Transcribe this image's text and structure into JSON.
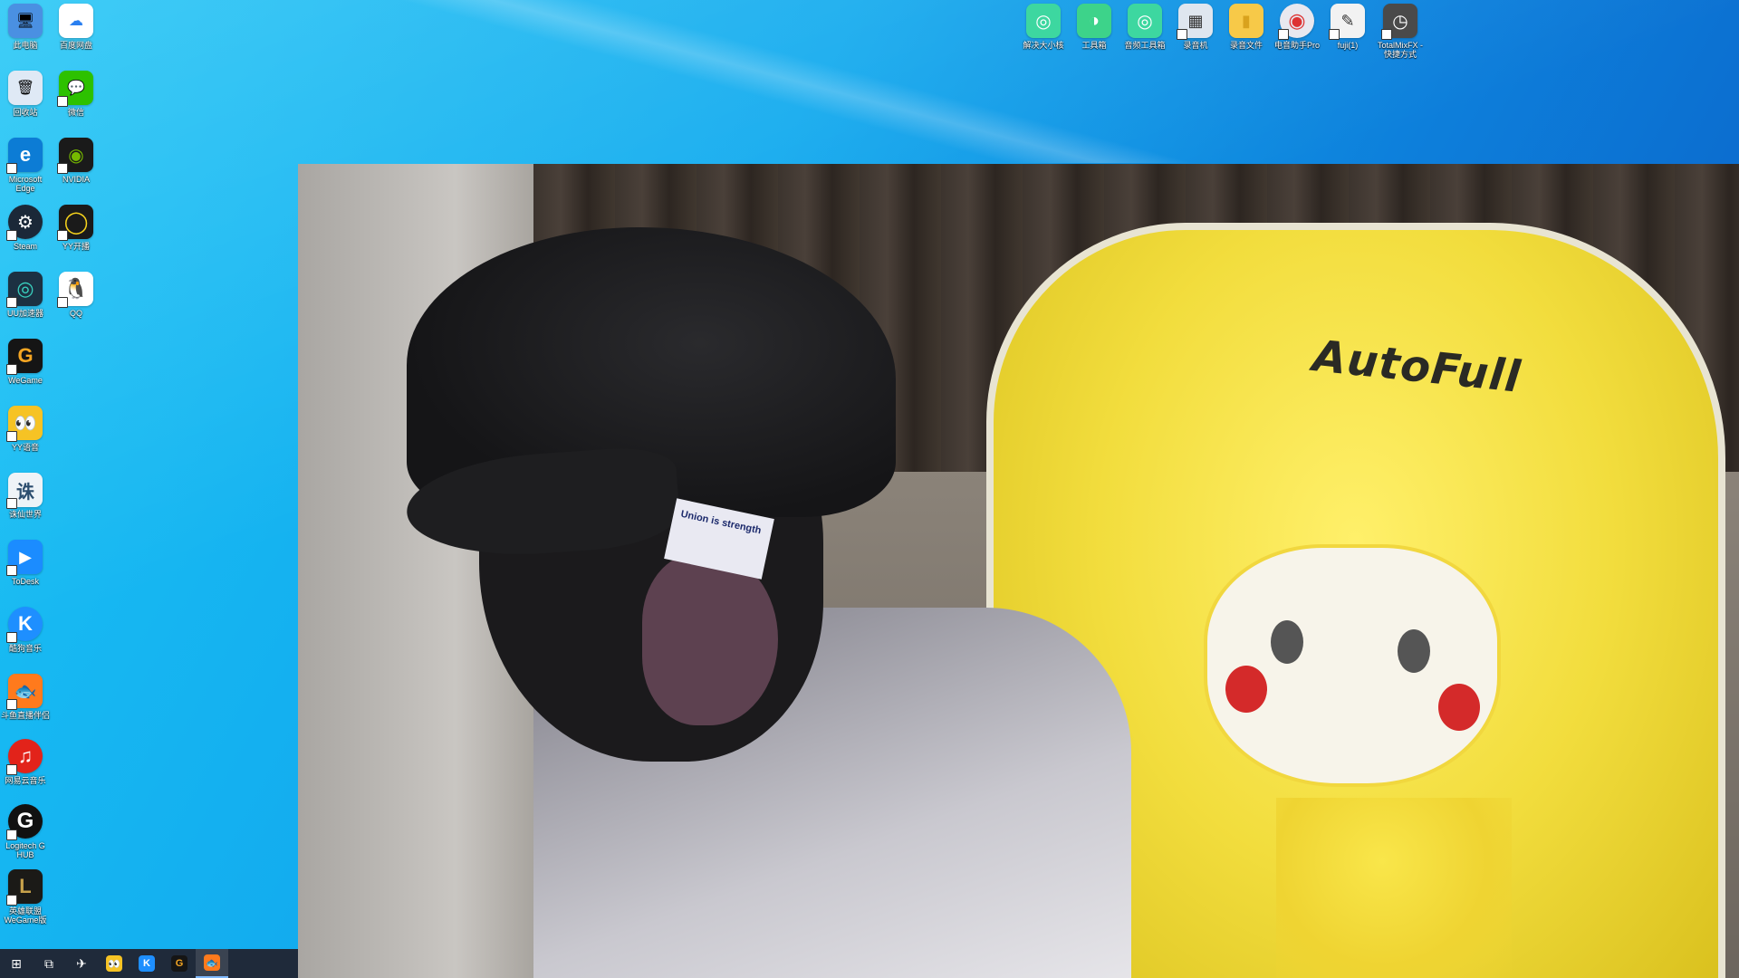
{
  "desktop_icons_left": [
    {
      "label": "此电脑",
      "icon": "computer-icon",
      "color": "#4a90e2",
      "glyph": "🖥"
    },
    {
      "label": "百度网盘",
      "icon": "baidu-netdisk-icon",
      "color": "#ffffff",
      "glyph": "☁"
    },
    {
      "label": "回收站",
      "icon": "recycle-bin-icon",
      "color": "#dfe9f5",
      "glyph": "🗑"
    },
    {
      "label": "微信",
      "icon": "wechat-icon",
      "color": "#2dc100",
      "glyph": "💬"
    },
    {
      "label": "Microsoft Edge",
      "icon": "edge-icon",
      "color": "#0c7cd5",
      "glyph": "e"
    },
    {
      "label": "NVIDIA",
      "icon": "nvidia-icon",
      "color": "#1a1a1a",
      "glyph": "◉"
    },
    {
      "label": "Steam",
      "icon": "steam-icon",
      "color": "#1b2838",
      "glyph": "⚙"
    },
    {
      "label": "YY开播",
      "icon": "yy-live-icon",
      "color": "#1a1a1a",
      "glyph": "◯"
    },
    {
      "label": "UU加速器",
      "icon": "uu-accelerator-icon",
      "color": "#1c3142",
      "glyph": "◎"
    },
    {
      "label": "QQ",
      "icon": "qq-icon",
      "color": "#ffffff",
      "glyph": "🐧"
    },
    {
      "label": "WeGame",
      "icon": "wegame-icon",
      "color": "#151515",
      "glyph": "G"
    },
    {
      "label": "YY语音",
      "icon": "yy-voice-icon",
      "color": "#f6c324",
      "glyph": "👀"
    },
    {
      "label": "诛仙世界",
      "icon": "zhuxian-world-icon",
      "color": "#eef3f7",
      "glyph": "诛"
    },
    {
      "label": "ToDesk",
      "icon": "todesk-icon",
      "color": "#1b8cff",
      "glyph": "▶"
    },
    {
      "label": "酷狗音乐",
      "icon": "kugou-music-icon",
      "color": "#1e8fff",
      "glyph": "K"
    },
    {
      "label": "斗鱼直播伴侣",
      "icon": "douyu-companion-icon",
      "color": "#ff7a1c",
      "glyph": "🐟"
    },
    {
      "label": "网易云音乐",
      "icon": "netease-music-icon",
      "color": "#e2231a",
      "glyph": "♫"
    },
    {
      "label": "Logitech G HUB",
      "icon": "logitech-ghub-icon",
      "color": "#111111",
      "glyph": "G"
    },
    {
      "label": "英雄联盟WeGame版",
      "icon": "lol-wegame-icon",
      "color": "#1b1a17",
      "glyph": "L"
    }
  ],
  "desktop_icons_top": [
    {
      "label": "解决大小核",
      "icon": "core-fix-icon",
      "color": "#3dd7a0",
      "glyph": "◎"
    },
    {
      "label": "工具箱",
      "icon": "toolbox-icon",
      "color": "#3dd38a",
      "glyph": "◑"
    },
    {
      "label": "音频工具箱",
      "icon": "audio-toolbox-icon",
      "color": "#3dd7a0",
      "glyph": "◎"
    },
    {
      "label": "录音机",
      "icon": "recorder-icon",
      "color": "#dfe6ef",
      "glyph": "▦"
    },
    {
      "label": "录音文件",
      "icon": "recording-folder-icon",
      "color": "#f7c948",
      "glyph": "▮"
    },
    {
      "label": "电音助手Pro",
      "icon": "electro-assistant-icon",
      "color": "#e8e8ef",
      "glyph": "◉"
    },
    {
      "label": "fuji(1)",
      "icon": "fuji-shortcut-icon",
      "color": "#f2f2f2",
      "glyph": "✎"
    },
    {
      "label": "TotalMixFX - 快捷方式",
      "icon": "totalmix-icon",
      "color": "#4a4a4a",
      "glyph": "◷"
    }
  ],
  "webcam": {
    "chair_brand": "AutoFull",
    "cap_tag_text": "Union is strength"
  },
  "taskbar": [
    {
      "name": "start-button",
      "icon": "windows-start-icon",
      "glyph": "⊞",
      "color": "#ffffff"
    },
    {
      "name": "task-view-button",
      "icon": "task-view-icon",
      "glyph": "⧉",
      "color": "#ffffff"
    },
    {
      "name": "taskbar-fuji",
      "icon": "fuji-icon",
      "glyph": "✈",
      "color": "#ffffff"
    },
    {
      "name": "taskbar-yy",
      "icon": "yy-voice-icon",
      "glyph": "👀",
      "color": "#f6c324"
    },
    {
      "name": "taskbar-kugou",
      "icon": "kugou-music-icon",
      "glyph": "K",
      "color": "#1e8fff"
    },
    {
      "name": "taskbar-wegame",
      "icon": "wegame-icon",
      "glyph": "G",
      "color": "#151515"
    },
    {
      "name": "taskbar-douyu",
      "icon": "douyu-companion-icon",
      "glyph": "🐟",
      "color": "#ff7a1c"
    }
  ]
}
